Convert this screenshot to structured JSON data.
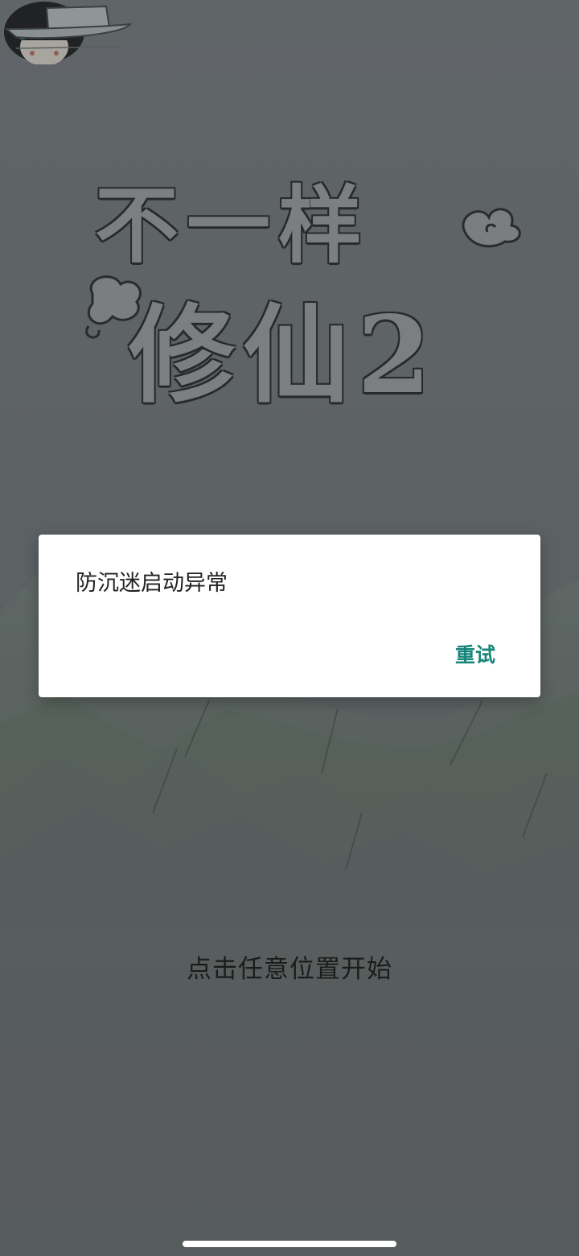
{
  "game": {
    "title_line_1": "不一样",
    "title_line_2": "修仙2",
    "start_hint": "点击任意位置开始"
  },
  "dialog": {
    "message": "防沉迷启动异常",
    "retry_label": "重试",
    "accent_color": "#17857a"
  },
  "icons": {
    "character": "character-avatar-icon",
    "boat": "boat-icon",
    "cloud": "cloud-swirl-icon"
  }
}
